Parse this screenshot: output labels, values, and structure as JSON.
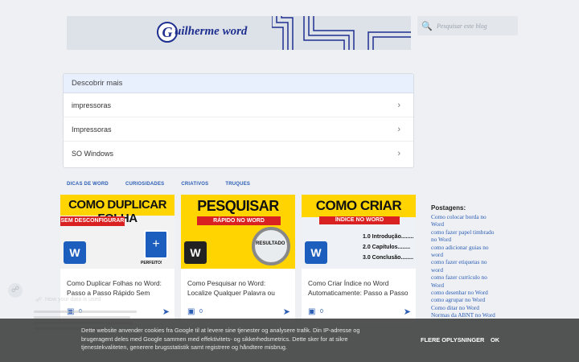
{
  "header": {
    "logo_letter": "G",
    "logo_text": "uilherme word",
    "search_placeholder": "Pesquisar este blog"
  },
  "discover": {
    "title": "Descobrir mais",
    "items": [
      {
        "label": "impressoras"
      },
      {
        "label": "Impressoras"
      },
      {
        "label": "SO Windows"
      }
    ]
  },
  "tabs": [
    "DICAS DE WORD",
    "CURIOSIDADES",
    "CRIATIVOS",
    "TRUQUES"
  ],
  "cards": [
    {
      "image_headline": "COMO DUPLICAR FOLHA",
      "image_sub": "SEM DESCONFIGURAR",
      "image_badge": "PERFEITO!",
      "title": "Como Duplicar Folhas no Word: Passo a Passo Rápido Sem",
      "comments": "0"
    },
    {
      "image_headline": "PESQUISAR",
      "image_sub": "RÁPIDO NO WORD",
      "image_badge": "RESULTADO",
      "title": "Como Pesquisar no Word: Localize Qualquer Palavra ou",
      "comments": "0"
    },
    {
      "image_headline": "COMO CRIAR",
      "image_sub": "ÍNDICE NO WORD",
      "image_list": [
        "1.0 Introdução........",
        "2.0 Capítulos........",
        "3.0 Conclusão........"
      ],
      "title": "Como Criar Índice no Word Automaticamente: Passo a Passo",
      "comments": "0"
    }
  ],
  "posts": {
    "heading": "Postagens:",
    "links": [
      "Como colocar borda no Word",
      "como fazer papel timbrado no Word",
      "como adicionar guias no word",
      "como fazer etiquetas no word",
      "como fazer currículo no Word",
      "como desenhar no Word",
      "como agrupar no Word",
      "Como ditar no Word",
      "Normas da ABNT no Word"
    ]
  },
  "cookie": {
    "message": "Dette website anvender cookies fra Google til at levere sine tjenester og analysere trafik. Din IP-adresse og brugeragent deles med Google sammen med effektivitets- og sikkerhedsmetrics. Dette sker for at sikre tjenestekvaliteten, generere brugsstatistik samt registrere og håndtere misbrug.",
    "more_label": "FLERE OPLYSNINGER",
    "ok_label": "OK"
  },
  "privacy": {
    "title": "How your data is used"
  },
  "colors": {
    "accent": "#2b5db3",
    "word_blue": "#1b5ebe",
    "thumb_red": "#d92121",
    "cookie_bg": "#3c3c3c"
  }
}
